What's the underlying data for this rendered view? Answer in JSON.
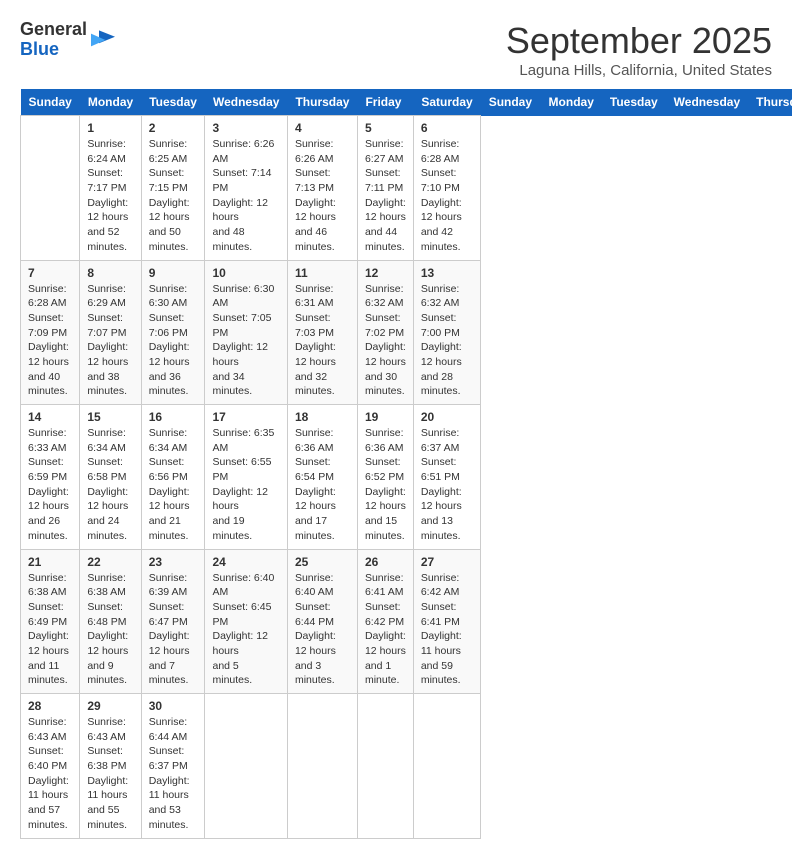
{
  "header": {
    "logo_general": "General",
    "logo_blue": "Blue",
    "month_title": "September 2025",
    "location": "Laguna Hills, California, United States"
  },
  "days_of_week": [
    "Sunday",
    "Monday",
    "Tuesday",
    "Wednesday",
    "Thursday",
    "Friday",
    "Saturday"
  ],
  "weeks": [
    [
      {
        "day": "",
        "info": ""
      },
      {
        "day": "1",
        "info": "Sunrise: 6:24 AM\nSunset: 7:17 PM\nDaylight: 12 hours\nand 52 minutes."
      },
      {
        "day": "2",
        "info": "Sunrise: 6:25 AM\nSunset: 7:15 PM\nDaylight: 12 hours\nand 50 minutes."
      },
      {
        "day": "3",
        "info": "Sunrise: 6:26 AM\nSunset: 7:14 PM\nDaylight: 12 hours\nand 48 minutes."
      },
      {
        "day": "4",
        "info": "Sunrise: 6:26 AM\nSunset: 7:13 PM\nDaylight: 12 hours\nand 46 minutes."
      },
      {
        "day": "5",
        "info": "Sunrise: 6:27 AM\nSunset: 7:11 PM\nDaylight: 12 hours\nand 44 minutes."
      },
      {
        "day": "6",
        "info": "Sunrise: 6:28 AM\nSunset: 7:10 PM\nDaylight: 12 hours\nand 42 minutes."
      }
    ],
    [
      {
        "day": "7",
        "info": "Sunrise: 6:28 AM\nSunset: 7:09 PM\nDaylight: 12 hours\nand 40 minutes."
      },
      {
        "day": "8",
        "info": "Sunrise: 6:29 AM\nSunset: 7:07 PM\nDaylight: 12 hours\nand 38 minutes."
      },
      {
        "day": "9",
        "info": "Sunrise: 6:30 AM\nSunset: 7:06 PM\nDaylight: 12 hours\nand 36 minutes."
      },
      {
        "day": "10",
        "info": "Sunrise: 6:30 AM\nSunset: 7:05 PM\nDaylight: 12 hours\nand 34 minutes."
      },
      {
        "day": "11",
        "info": "Sunrise: 6:31 AM\nSunset: 7:03 PM\nDaylight: 12 hours\nand 32 minutes."
      },
      {
        "day": "12",
        "info": "Sunrise: 6:32 AM\nSunset: 7:02 PM\nDaylight: 12 hours\nand 30 minutes."
      },
      {
        "day": "13",
        "info": "Sunrise: 6:32 AM\nSunset: 7:00 PM\nDaylight: 12 hours\nand 28 minutes."
      }
    ],
    [
      {
        "day": "14",
        "info": "Sunrise: 6:33 AM\nSunset: 6:59 PM\nDaylight: 12 hours\nand 26 minutes."
      },
      {
        "day": "15",
        "info": "Sunrise: 6:34 AM\nSunset: 6:58 PM\nDaylight: 12 hours\nand 24 minutes."
      },
      {
        "day": "16",
        "info": "Sunrise: 6:34 AM\nSunset: 6:56 PM\nDaylight: 12 hours\nand 21 minutes."
      },
      {
        "day": "17",
        "info": "Sunrise: 6:35 AM\nSunset: 6:55 PM\nDaylight: 12 hours\nand 19 minutes."
      },
      {
        "day": "18",
        "info": "Sunrise: 6:36 AM\nSunset: 6:54 PM\nDaylight: 12 hours\nand 17 minutes."
      },
      {
        "day": "19",
        "info": "Sunrise: 6:36 AM\nSunset: 6:52 PM\nDaylight: 12 hours\nand 15 minutes."
      },
      {
        "day": "20",
        "info": "Sunrise: 6:37 AM\nSunset: 6:51 PM\nDaylight: 12 hours\nand 13 minutes."
      }
    ],
    [
      {
        "day": "21",
        "info": "Sunrise: 6:38 AM\nSunset: 6:49 PM\nDaylight: 12 hours\nand 11 minutes."
      },
      {
        "day": "22",
        "info": "Sunrise: 6:38 AM\nSunset: 6:48 PM\nDaylight: 12 hours\nand 9 minutes."
      },
      {
        "day": "23",
        "info": "Sunrise: 6:39 AM\nSunset: 6:47 PM\nDaylight: 12 hours\nand 7 minutes."
      },
      {
        "day": "24",
        "info": "Sunrise: 6:40 AM\nSunset: 6:45 PM\nDaylight: 12 hours\nand 5 minutes."
      },
      {
        "day": "25",
        "info": "Sunrise: 6:40 AM\nSunset: 6:44 PM\nDaylight: 12 hours\nand 3 minutes."
      },
      {
        "day": "26",
        "info": "Sunrise: 6:41 AM\nSunset: 6:42 PM\nDaylight: 12 hours\nand 1 minute."
      },
      {
        "day": "27",
        "info": "Sunrise: 6:42 AM\nSunset: 6:41 PM\nDaylight: 11 hours\nand 59 minutes."
      }
    ],
    [
      {
        "day": "28",
        "info": "Sunrise: 6:43 AM\nSunset: 6:40 PM\nDaylight: 11 hours\nand 57 minutes."
      },
      {
        "day": "29",
        "info": "Sunrise: 6:43 AM\nSunset: 6:38 PM\nDaylight: 11 hours\nand 55 minutes."
      },
      {
        "day": "30",
        "info": "Sunrise: 6:44 AM\nSunset: 6:37 PM\nDaylight: 11 hours\nand 53 minutes."
      },
      {
        "day": "",
        "info": ""
      },
      {
        "day": "",
        "info": ""
      },
      {
        "day": "",
        "info": ""
      },
      {
        "day": "",
        "info": ""
      }
    ]
  ]
}
